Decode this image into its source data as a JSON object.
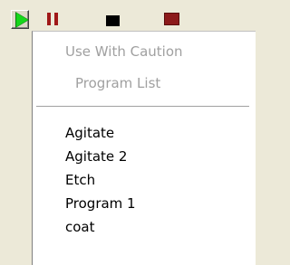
{
  "toolbar": {
    "buttons": [
      {
        "icon": "play-icon",
        "color": "#16d61c"
      },
      {
        "icon": "pause-icon",
        "color": "#a01818"
      },
      {
        "icon": "stop-icon",
        "color": "#000000"
      },
      {
        "icon": "record-icon",
        "color": "#8c1a1a"
      }
    ]
  },
  "menu": {
    "header_items": [
      {
        "label": "Use With Caution",
        "enabled": false
      },
      {
        "label": "Program List",
        "enabled": false
      }
    ],
    "programs": [
      {
        "label": "Agitate"
      },
      {
        "label": "Agitate 2"
      },
      {
        "label": "Etch"
      },
      {
        "label": "Program 1"
      },
      {
        "label": "coat"
      }
    ]
  }
}
